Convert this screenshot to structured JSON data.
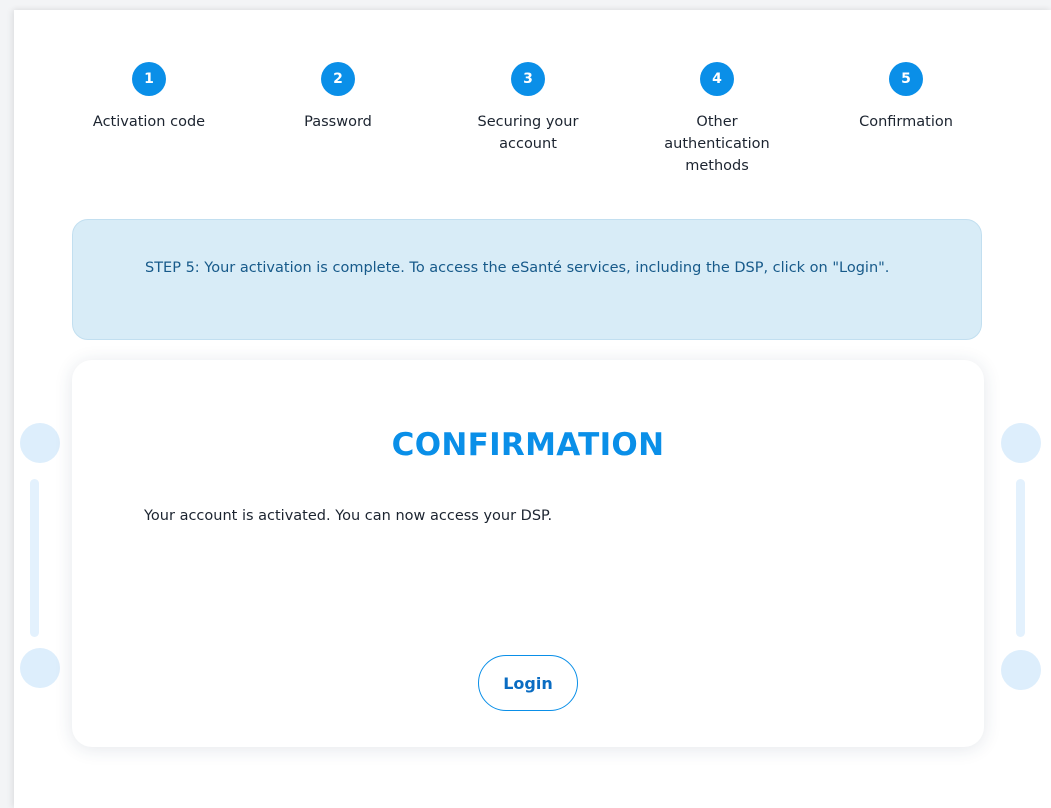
{
  "stepper": {
    "steps": [
      {
        "number": "1",
        "label": "Activation code"
      },
      {
        "number": "2",
        "label": "Password"
      },
      {
        "number": "3",
        "label": "Securing your account"
      },
      {
        "number": "4",
        "label": "Other authentication methods"
      },
      {
        "number": "5",
        "label": "Confirmation"
      }
    ]
  },
  "banner": {
    "text": "STEP 5: Your activation is complete. To access the eSanté services, including the DSP, click on \"Login\"."
  },
  "card": {
    "title": "CONFIRMATION",
    "message": "Your account is activated. You can now access your DSP.",
    "login_label": "Login"
  },
  "colors": {
    "accent": "#0a8fe8",
    "banner_background": "#d8ecf7",
    "banner_text": "#175a8a",
    "text": "#1c2430"
  }
}
